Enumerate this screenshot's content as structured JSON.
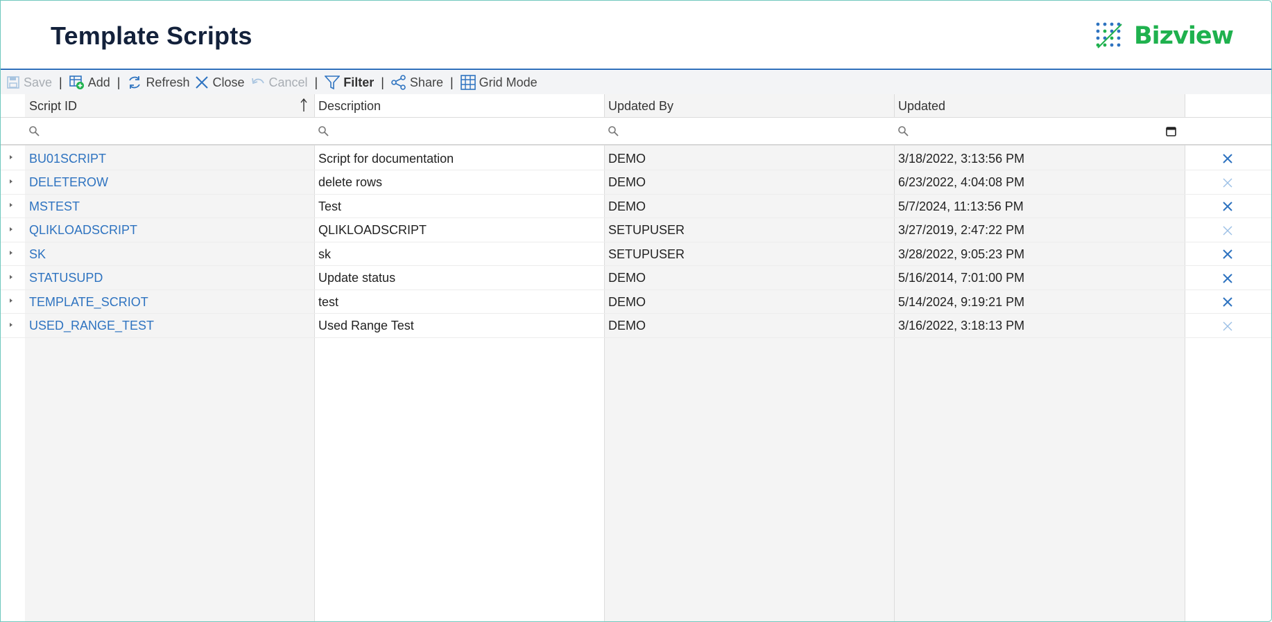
{
  "header": {
    "title": "Template Scripts",
    "logo_text": "Bizview"
  },
  "toolbar": {
    "save": "Save",
    "add": "Add",
    "refresh": "Refresh",
    "close": "Close",
    "cancel": "Cancel",
    "filter": "Filter",
    "share": "Share",
    "grid_mode": "Grid Mode"
  },
  "columns": [
    "Script ID",
    "Description",
    "Updated By",
    "Updated"
  ],
  "rows": [
    {
      "id": "BU01SCRIPT",
      "description": "Script for documentation",
      "updated_by": "DEMO",
      "updated": "3/18/2022, 3:13:56 PM",
      "delete_active": true
    },
    {
      "id": "DELETEROW",
      "description": "delete rows",
      "updated_by": "DEMO",
      "updated": "6/23/2022, 4:04:08 PM",
      "delete_active": false
    },
    {
      "id": "MSTEST",
      "description": "Test",
      "updated_by": "DEMO",
      "updated": "5/7/2024, 11:13:56 PM",
      "delete_active": true
    },
    {
      "id": "QLIKLOADSCRIPT",
      "description": "QLIKLOADSCRIPT",
      "updated_by": "SETUPUSER",
      "updated": "3/27/2019, 2:47:22 PM",
      "delete_active": false
    },
    {
      "id": "SK",
      "description": "sk",
      "updated_by": "SETUPUSER",
      "updated": "3/28/2022, 9:05:23 PM",
      "delete_active": true
    },
    {
      "id": "STATUSUPD",
      "description": "Update status",
      "updated_by": "DEMO",
      "updated": "5/16/2014, 7:01:00 PM",
      "delete_active": true
    },
    {
      "id": "TEMPLATE_SCRIOT",
      "description": "test",
      "updated_by": "DEMO",
      "updated": "5/14/2024, 9:19:21 PM",
      "delete_active": true
    },
    {
      "id": "USED_RANGE_TEST",
      "description": "Used Range Test",
      "updated_by": "DEMO",
      "updated": "3/16/2022, 3:18:13 PM",
      "delete_active": false
    }
  ],
  "colors": {
    "accent": "#2e73c0",
    "logo": "#1fb14e",
    "title": "#13213b"
  }
}
